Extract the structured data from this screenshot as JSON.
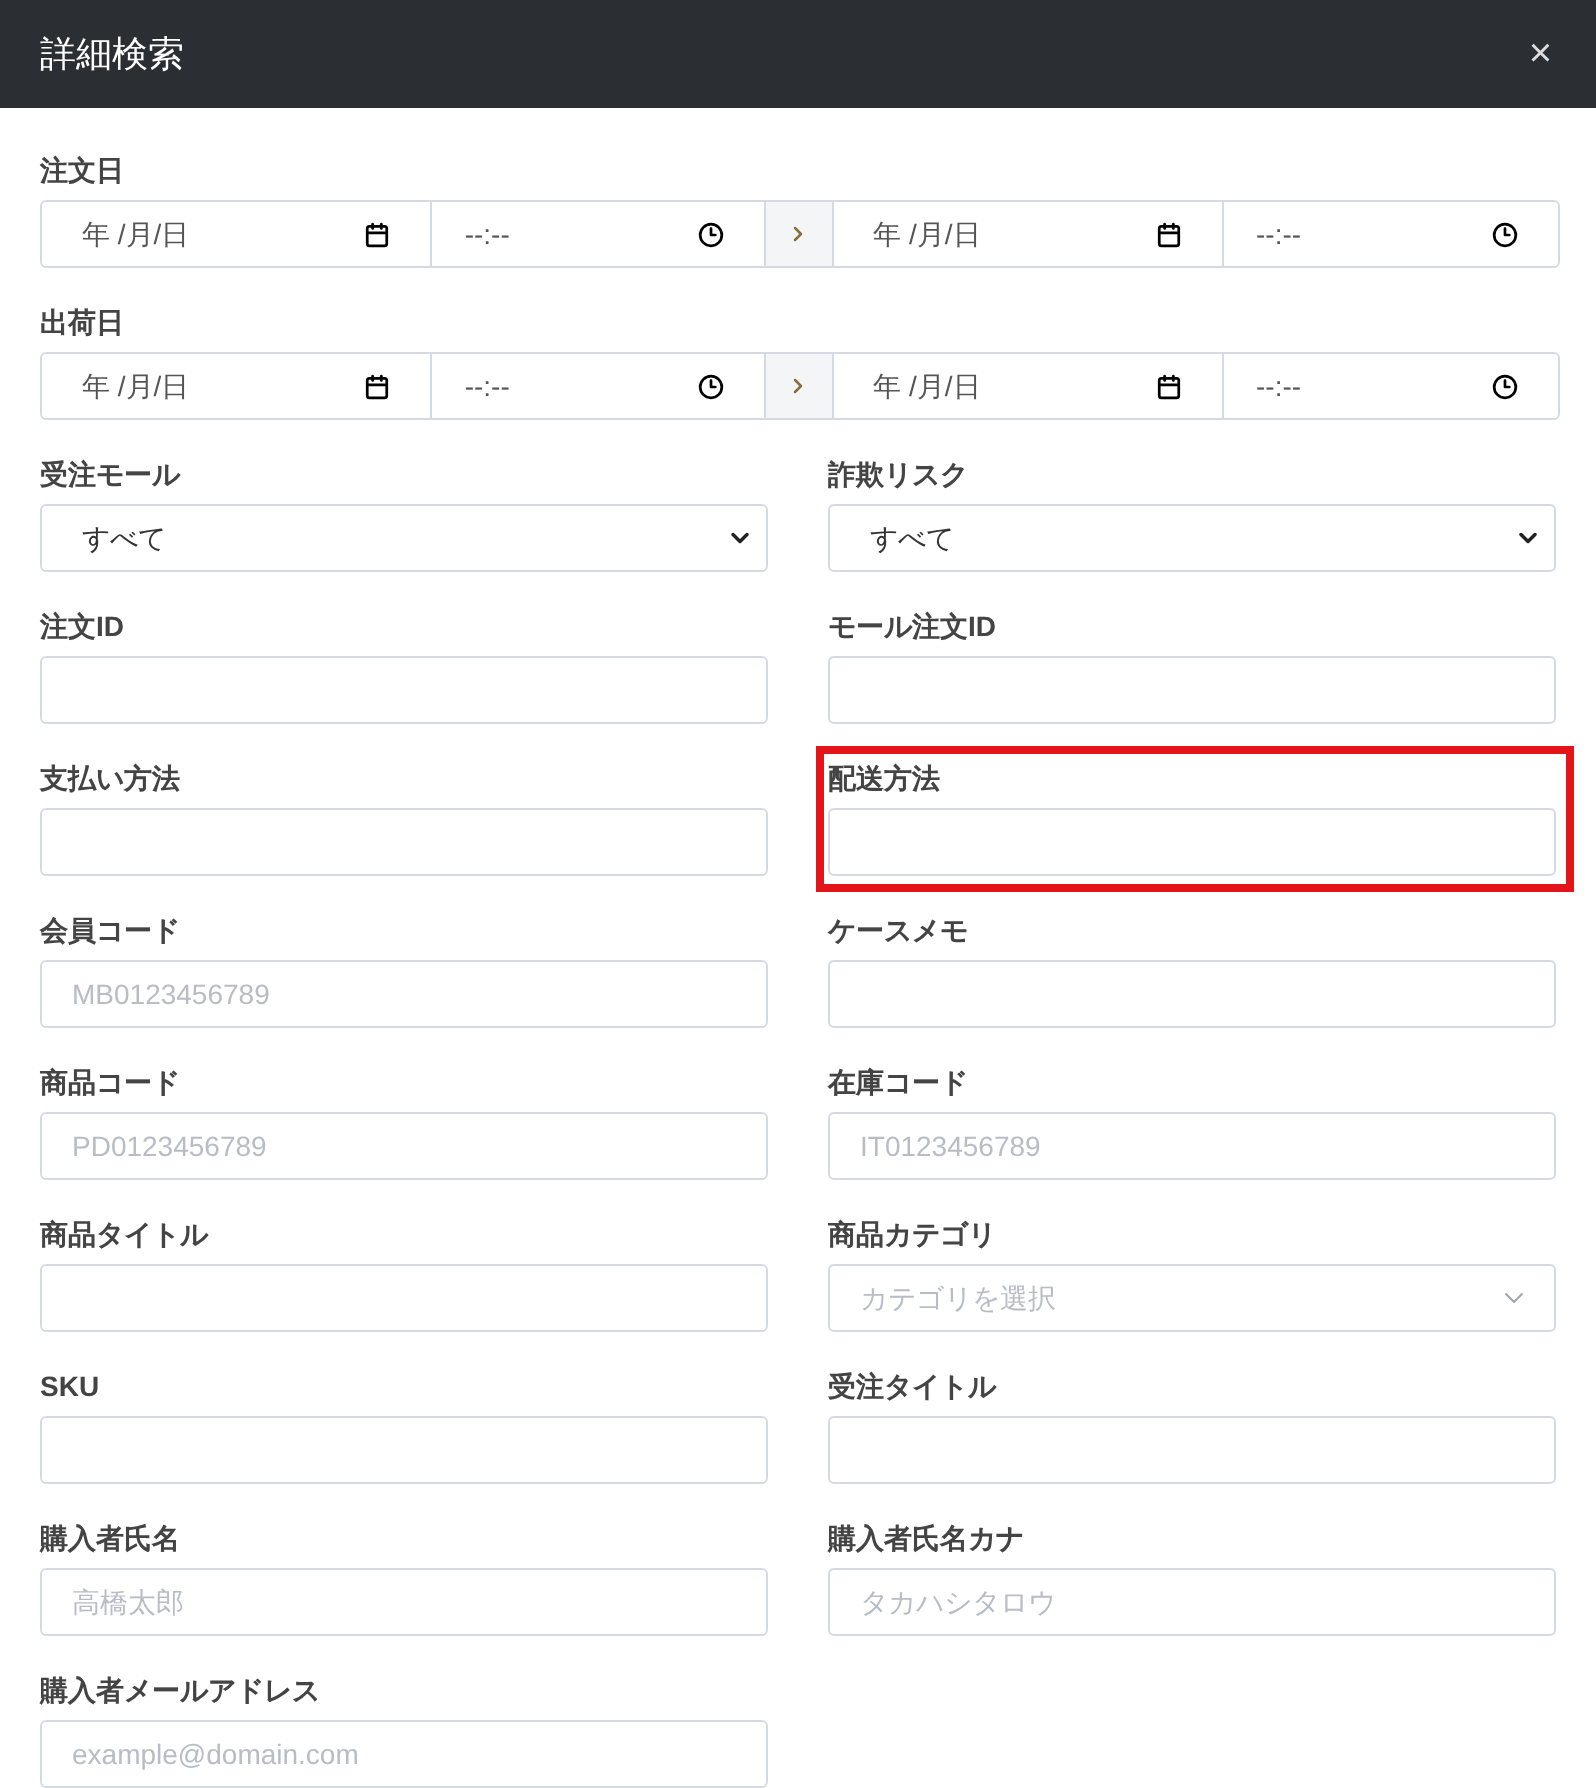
{
  "dialog": {
    "title": "詳細検索",
    "close": "×"
  },
  "date_ranges": [
    {
      "label": "注文日",
      "from_date": "年 /月/日",
      "from_time": "--:--",
      "to_date": "年 /月/日",
      "to_time": "--:--"
    },
    {
      "label": "出荷日",
      "from_date": "年 /月/日",
      "from_time": "--:--",
      "to_date": "年 /月/日",
      "to_time": "--:--"
    }
  ],
  "fields": [
    {
      "label": "受注モール",
      "kind": "select",
      "value": "すべて"
    },
    {
      "label": "詐欺リスク",
      "kind": "select",
      "value": "すべて"
    },
    {
      "label": "注文ID",
      "kind": "text"
    },
    {
      "label": "モール注文ID",
      "kind": "text"
    },
    {
      "label": "支払い方法",
      "kind": "text"
    },
    {
      "label": "配送方法",
      "kind": "text",
      "highlighted": true
    },
    {
      "label": "会員コード",
      "kind": "text",
      "placeholder": "MB0123456789"
    },
    {
      "label": "ケースメモ",
      "kind": "text"
    },
    {
      "label": "商品コード",
      "kind": "text",
      "placeholder": "PD0123456789"
    },
    {
      "label": "在庫コード",
      "kind": "text",
      "placeholder": "IT0123456789"
    },
    {
      "label": "商品タイトル",
      "kind": "text"
    },
    {
      "label": "商品カテゴリ",
      "kind": "combo",
      "placeholder": "カテゴリを選択"
    },
    {
      "label": "SKU",
      "kind": "text"
    },
    {
      "label": "受注タイトル",
      "kind": "text"
    },
    {
      "label": "購入者氏名",
      "kind": "text",
      "placeholder": "高橋太郎"
    },
    {
      "label": "購入者氏名カナ",
      "kind": "text",
      "placeholder": "タカハシタロウ"
    },
    {
      "label": "購入者メールアドレス",
      "kind": "text",
      "placeholder": "example@domain.com"
    }
  ]
}
